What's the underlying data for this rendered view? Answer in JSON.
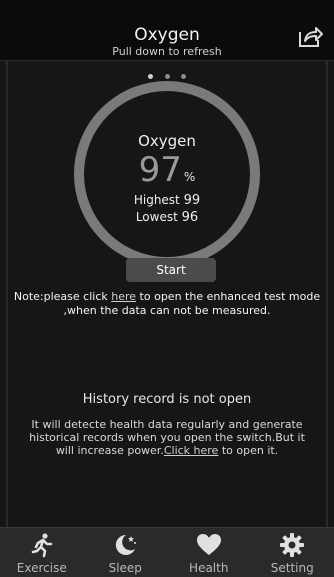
{
  "header": {
    "title": "Oxygen",
    "subtitle": "Pull down to refresh",
    "share_icon": "share-icon"
  },
  "pager": {
    "total": 3,
    "active_index": 0
  },
  "gauge": {
    "label": "Oxygen",
    "value": "97",
    "unit": "%",
    "highest_label": "Highest",
    "highest_value": "99",
    "lowest_label": "Lowest",
    "lowest_value": "96",
    "ring_color": "#7a7a7a"
  },
  "start_button": {
    "label": "Start"
  },
  "note": {
    "prefix": "Note:please click ",
    "link": "here",
    "suffix": " to open the enhanced test mode ,when the data can not be measured."
  },
  "history": {
    "title": "History record is not open",
    "desc_prefix": "It will detecte health data regularly and generate historical records when you open the switch.But it will increase power.",
    "desc_link": "Click here",
    "desc_suffix": " to open it."
  },
  "nav": {
    "items": [
      {
        "label": "Exercise",
        "icon": "running-person-icon"
      },
      {
        "label": "Sleep",
        "icon": "moon-stars-icon"
      },
      {
        "label": "Health",
        "icon": "heart-icon"
      },
      {
        "label": "Setting",
        "icon": "gear-icon"
      }
    ]
  },
  "colors": {
    "background": "#161616",
    "header": "#0b0b0b",
    "nav": "#2a2a2a",
    "accent_text": "#f0f0f0"
  }
}
